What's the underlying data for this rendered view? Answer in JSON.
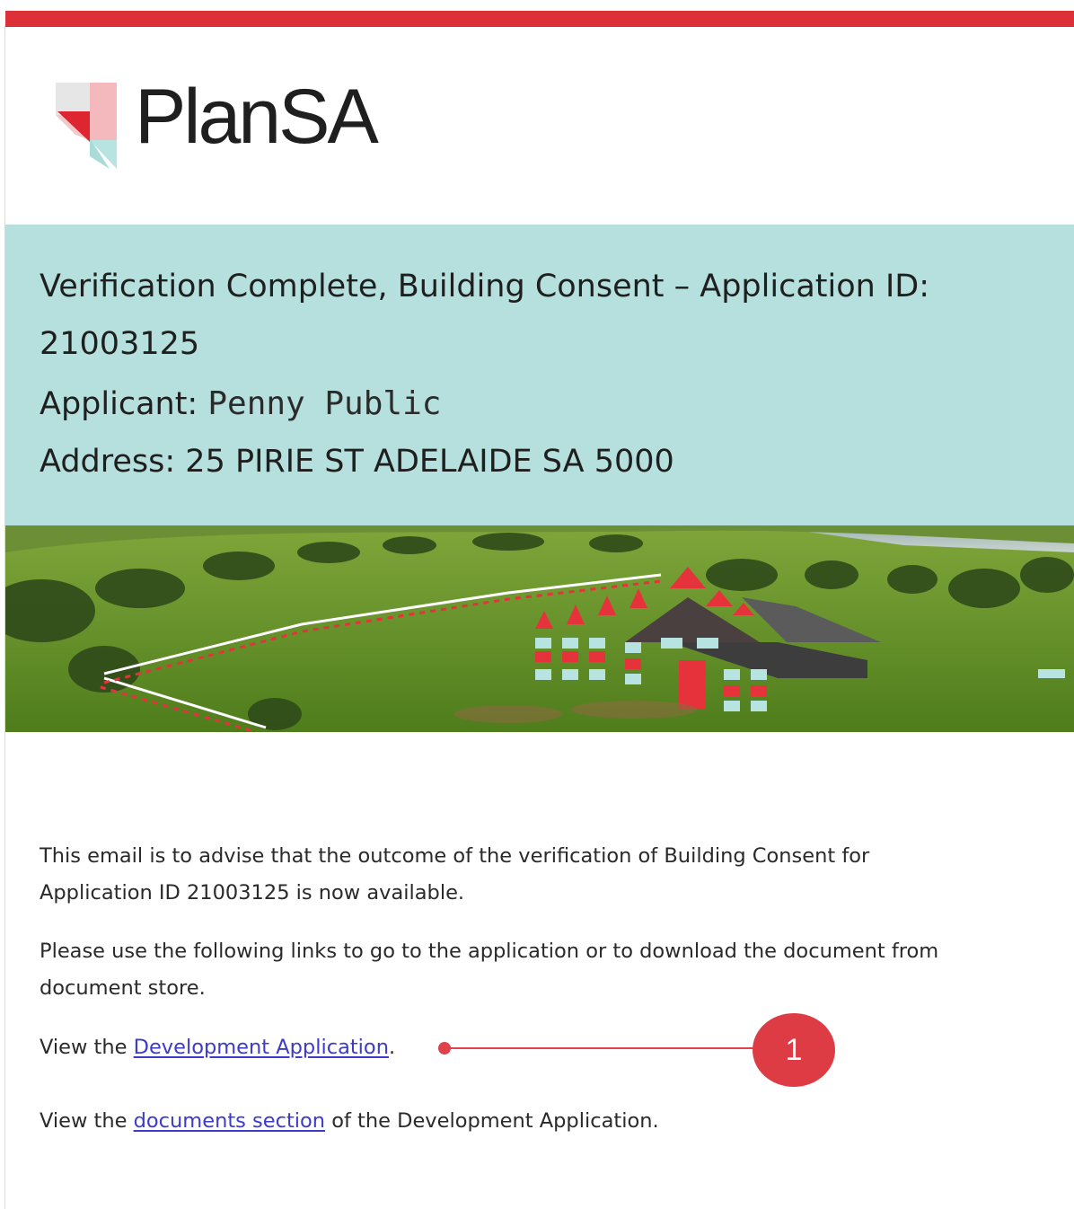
{
  "brand": {
    "name": "PlanSA",
    "accent_color": "#dc3139",
    "header_color": "#b6e0dd"
  },
  "header": {
    "line1": "Verification Complete, Building Consent – Application ID:",
    "line2": "21003125",
    "applicant_label": "Applicant: ",
    "applicant_name": "Penny Public",
    "address": "Address: 25 PIRIE ST ADELAIDE SA 5000"
  },
  "hero": {
    "description": "farmland-with-house-outline-graphic"
  },
  "body": {
    "para1_line1": "This email is to advise that the outcome of the verification of Building Consent for",
    "para1_line2": "Application ID 21003125 is now available.",
    "para2_line1": "Please use the following links to go to the application or to download the document from",
    "para2_line2": "document store.",
    "view_prefix_1": "View the ",
    "dev_app_link": "Development Application",
    "view_suffix_1": ".",
    "view_prefix_2": "View the ",
    "documents_link": "documents section",
    "view_suffix_2": " of the Development Application."
  },
  "callout": {
    "number": "1",
    "color": "#dd3c44"
  }
}
